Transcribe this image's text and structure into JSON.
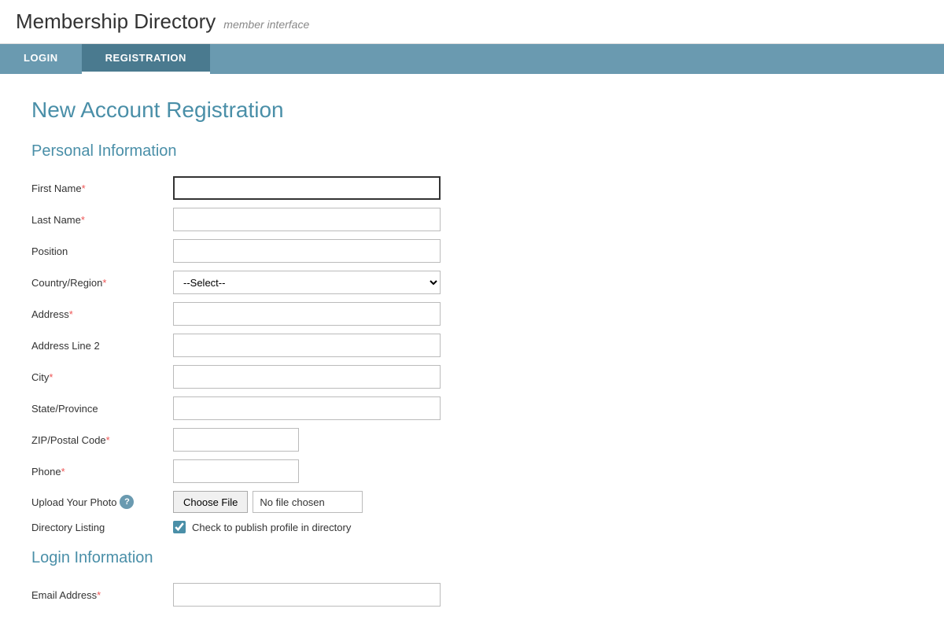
{
  "header": {
    "site_title": "Membership Directory",
    "site_subtitle": "member interface"
  },
  "nav": {
    "items": [
      {
        "label": "LOGIN",
        "id": "login",
        "active": false
      },
      {
        "label": "REGISTRATION",
        "id": "registration",
        "active": true
      }
    ]
  },
  "page": {
    "title": "New Account Registration",
    "sections": {
      "personal": {
        "title": "Personal Information",
        "fields": {
          "first_name": {
            "label": "First Name",
            "required": true,
            "placeholder": ""
          },
          "last_name": {
            "label": "Last Name",
            "required": true,
            "placeholder": ""
          },
          "position": {
            "label": "Position",
            "required": false,
            "placeholder": ""
          },
          "country_region": {
            "label": "Country/Region",
            "required": true
          },
          "address": {
            "label": "Address",
            "required": true,
            "placeholder": ""
          },
          "address2": {
            "label": "Address Line 2",
            "required": false,
            "placeholder": ""
          },
          "city": {
            "label": "City",
            "required": true,
            "placeholder": ""
          },
          "state_province": {
            "label": "State/Province",
            "required": false,
            "placeholder": ""
          },
          "zip": {
            "label": "ZIP/Postal Code",
            "required": true,
            "placeholder": ""
          },
          "phone": {
            "label": "Phone",
            "required": true,
            "placeholder": ""
          }
        },
        "country_select_default": "--Select--",
        "upload_photo": {
          "label": "Upload Your Photo",
          "choose_btn": "Choose File",
          "no_file_text": "No file chosen"
        },
        "directory_listing": {
          "label": "Directory Listing",
          "checkbox_label": "Check to publish profile in directory",
          "checked": true
        }
      },
      "login": {
        "title": "Login Information",
        "fields": {
          "email": {
            "label": "Email Address",
            "required": true,
            "placeholder": ""
          }
        }
      }
    }
  }
}
